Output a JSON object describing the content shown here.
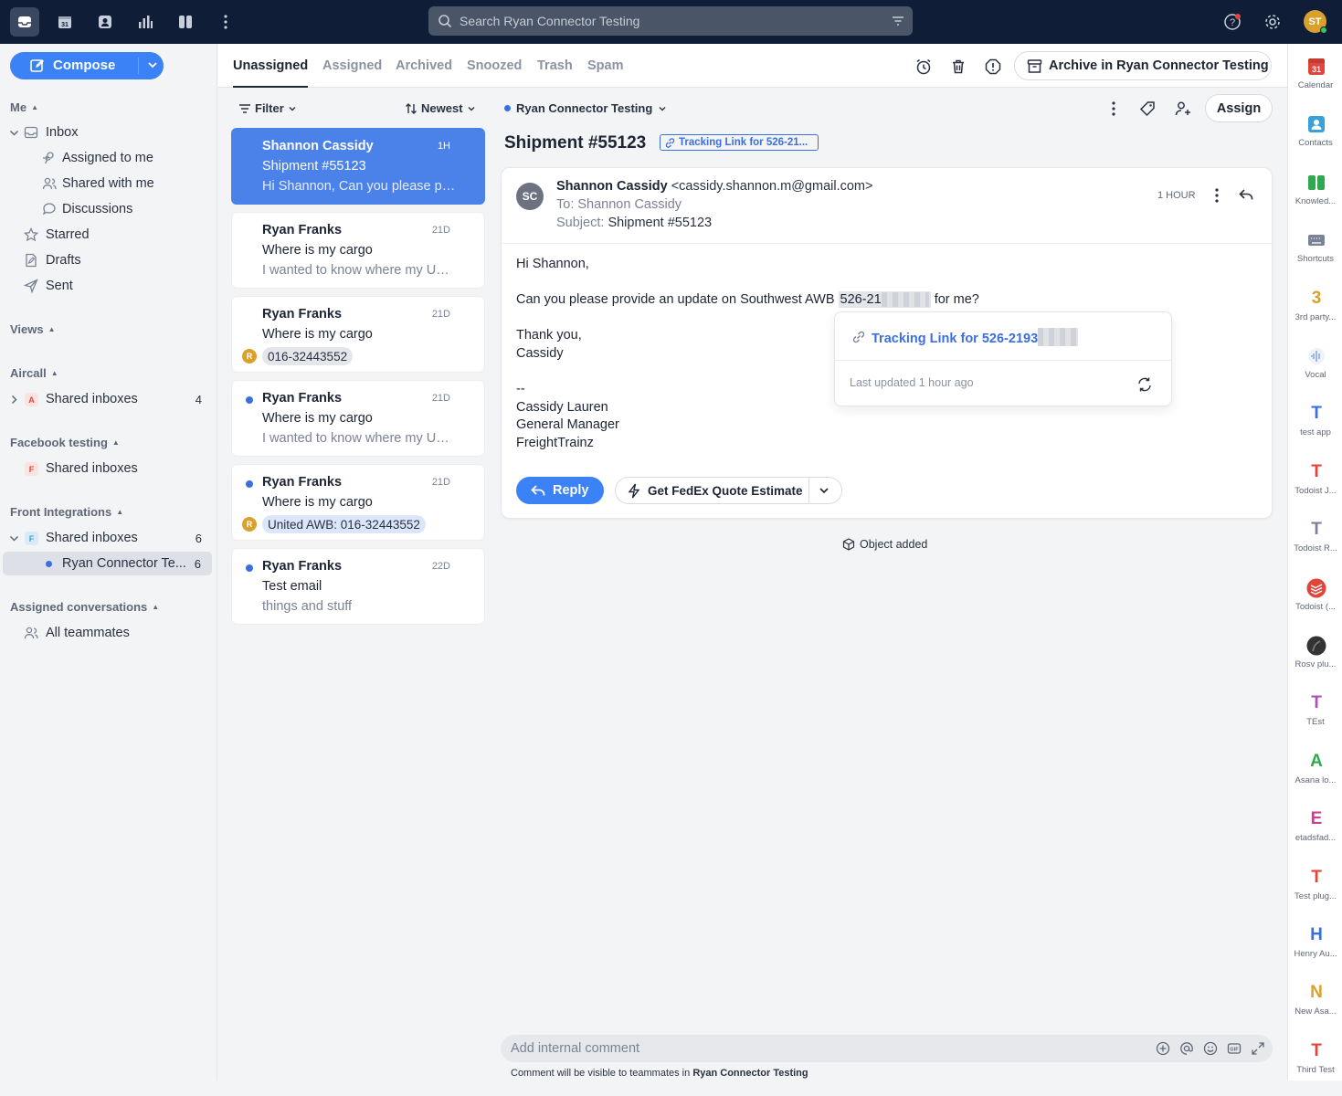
{
  "topbar": {
    "search_placeholder": "Search Ryan Connector Testing",
    "avatar_initials": "ST",
    "nav_icons": [
      "inbox-icon",
      "calendar-icon",
      "contacts-icon",
      "analytics-icon",
      "split-view-icon",
      "more-icon"
    ],
    "calendar_day": "31"
  },
  "sidebar": {
    "compose_label": "Compose",
    "me_section": "Me",
    "inbox": "Inbox",
    "assigned_to_me": "Assigned to me",
    "shared_with_me": "Shared with me",
    "discussions": "Discussions",
    "starred": "Starred",
    "drafts": "Drafts",
    "sent": "Sent",
    "views_section": "Views",
    "aircall_section": "Aircall",
    "aircall_shared": "Shared inboxes",
    "aircall_letter": "A",
    "aircall_count": "4",
    "facebook_section": "Facebook testing",
    "facebook_shared": "Shared inboxes",
    "facebook_letter": "F",
    "front_section": "Front Integrations",
    "front_shared": "Shared inboxes",
    "front_letter": "F",
    "front_count": "6",
    "ryan_inbox": "Ryan Connector Te...",
    "ryan_count": "6",
    "assigned_section": "Assigned conversations",
    "all_teammates": "All teammates"
  },
  "tabs": {
    "items": [
      "Unassigned",
      "Assigned",
      "Archived",
      "Snoozed",
      "Trash",
      "Spam"
    ],
    "active": "Unassigned",
    "archive_label": "Archive in Ryan Connector Testing"
  },
  "list": {
    "filter_label": "Filter",
    "sort_label": "Newest",
    "cards": [
      {
        "from": "Shannon Cassidy",
        "time": "1H",
        "subject": "Shipment #55123",
        "preview": "Hi Shannon, Can you please provide an update"
      },
      {
        "from": "Ryan Franks",
        "time": "21D",
        "subject": "Where is my cargo",
        "preview": "I wanted to know where my United cargo is"
      },
      {
        "from": "Ryan Franks",
        "time": "21D",
        "subject": "Where is my cargo",
        "tag": "016-32443552",
        "tag_avatar": "R"
      },
      {
        "from": "Ryan Franks",
        "time": "21D",
        "subject": "Where is my cargo",
        "preview": "I wanted to know where my United cargo is"
      },
      {
        "from": "Ryan Franks",
        "time": "21D",
        "subject": "Where is my cargo",
        "tag": "United AWB: 016-32443552",
        "tag_avatar": "R"
      },
      {
        "from": "Ryan Franks",
        "time": "22D",
        "subject": "Test email",
        "preview": "things and stuff"
      }
    ]
  },
  "conversation": {
    "inbox_name": "Ryan Connector Testing",
    "assign_label": "Assign",
    "title": "Shipment #55123",
    "link_chip": "Tracking Link for 526-21...",
    "message": {
      "avatar": "SC",
      "from_name": "Shannon Cassidy",
      "from_email": "<cassidy.shannon.m@gmail.com>",
      "to": "To: Shannon Cassidy",
      "subject_label": "Subject:",
      "subject": "Shipment #55123",
      "when": "1 HOUR",
      "greeting": "Hi Shannon,",
      "line1_pre": "Can you please provide an update on Southwest AWB",
      "awb_visible": "526-21",
      "line1_post": "for me?",
      "thanks": "Thank you,",
      "name": "Cassidy",
      "sig_dash": "--",
      "sig_name": "Cassidy Lauren",
      "sig_title": "General Manager",
      "sig_company": "FreightTrainz"
    },
    "popover": {
      "link_text": "Tracking Link for 526-2193",
      "updated": "Last updated 1 hour ago"
    },
    "reply_label": "Reply",
    "fedex_label": "Get FedEx Quote Estimate",
    "object_added": "Object added",
    "comment_placeholder": "Add internal comment",
    "comment_note_pre": "Comment will be visible to teammates in",
    "comment_note_inbox": "Ryan Connector Testing"
  },
  "apps": [
    {
      "label": "Calendar",
      "icon": "31",
      "color": "#e0453b"
    },
    {
      "label": "Contacts",
      "icon": "contact",
      "color": "#3aa0d8"
    },
    {
      "label": "Knowled...",
      "icon": "book",
      "color": "#2fa84f"
    },
    {
      "label": "Shortcuts",
      "icon": "keyboard",
      "color": "#7a8394"
    },
    {
      "label": "3rd party...",
      "icon": "3",
      "color": "#d9a02c"
    },
    {
      "label": "Vocal",
      "icon": "wave",
      "color": "#8aa4d8"
    },
    {
      "label": "test app",
      "icon": "T",
      "color": "#3b6fe0"
    },
    {
      "label": "Todoist J...",
      "icon": "T",
      "color": "#e0453b"
    },
    {
      "label": "Todoist R...",
      "icon": "T",
      "color": "#7a8394"
    },
    {
      "label": "Todoist (...",
      "icon": "todoist",
      "color": "#e0453b"
    },
    {
      "label": "Rosv plu...",
      "icon": "photo",
      "color": "#333"
    },
    {
      "label": "TEst",
      "icon": "T",
      "color": "#b04fb8"
    },
    {
      "label": "Asana lo...",
      "icon": "A",
      "color": "#2fa84f"
    },
    {
      "label": "etadsfad...",
      "icon": "E",
      "color": "#c2458c"
    },
    {
      "label": "Test plug...",
      "icon": "T",
      "color": "#e0453b"
    },
    {
      "label": "Henry Au...",
      "icon": "H",
      "color": "#3b6fe0"
    },
    {
      "label": "New Asa...",
      "icon": "N",
      "color": "#d9a02c"
    },
    {
      "label": "Third Test",
      "icon": "T",
      "color": "#e0453b"
    }
  ]
}
